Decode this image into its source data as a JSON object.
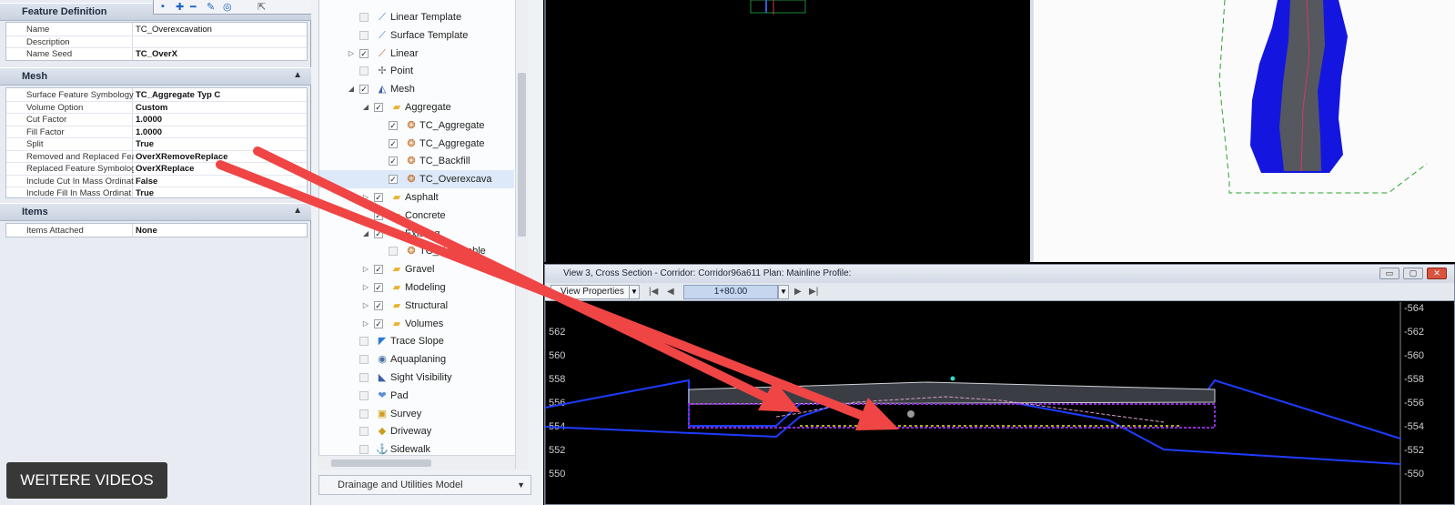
{
  "toolbar": {
    "icons": [
      "select-icon",
      "add-icon",
      "remove-icon",
      "edit-icon",
      "target-icon"
    ]
  },
  "feature_definition": {
    "title": "Feature Definition",
    "rows": [
      {
        "key": "Name",
        "value": "TC_Overexcavation"
      },
      {
        "key": "Description",
        "value": ""
      },
      {
        "key": "Name Seed",
        "value": "TC_OverX"
      }
    ]
  },
  "mesh": {
    "title": "Mesh",
    "rows": [
      {
        "key": "Surface Feature Symbology",
        "value": "TC_Aggregate Typ C"
      },
      {
        "key": "Volume Option",
        "value": "Custom"
      },
      {
        "key": "Cut Factor",
        "value": "1.0000"
      },
      {
        "key": "Fill Factor",
        "value": "1.0000"
      },
      {
        "key": "Split",
        "value": "True"
      },
      {
        "key": "Removed and Replaced Fea",
        "value": "OverXRemoveReplace"
      },
      {
        "key": "Replaced Feature Symbolog",
        "value": "OverXReplace"
      },
      {
        "key": "Include Cut In Mass Ordinat",
        "value": "False"
      },
      {
        "key": "Include Fill In Mass Ordinat",
        "value": "True"
      }
    ]
  },
  "items": {
    "title": "Items",
    "rows": [
      {
        "key": "Items Attached",
        "value": "None"
      }
    ]
  },
  "tree": {
    "items": [
      {
        "label": "Linear Template",
        "level": 1,
        "checked": false,
        "expand": "",
        "icon": "template-icon"
      },
      {
        "label": "Surface Template",
        "level": 1,
        "checked": false,
        "expand": "",
        "icon": "template-icon"
      },
      {
        "label": "Linear",
        "level": 1,
        "checked": true,
        "expand": "▷",
        "icon": "linear-icon"
      },
      {
        "label": "Point",
        "level": 1,
        "checked": false,
        "expand": "",
        "icon": "point-icon"
      },
      {
        "label": "Mesh",
        "level": 1,
        "checked": true,
        "expand": "◢",
        "icon": "mesh-icon"
      },
      {
        "label": "Aggregate",
        "level": 2,
        "checked": true,
        "expand": "◢",
        "icon": "folder-icon"
      },
      {
        "label": "TC_Aggregate",
        "level": 3,
        "checked": true,
        "expand": "",
        "icon": "feature-icon"
      },
      {
        "label": "TC_Aggregate",
        "level": 3,
        "checked": true,
        "expand": "",
        "icon": "feature-icon"
      },
      {
        "label": "TC_Backfill",
        "level": 3,
        "checked": true,
        "expand": "",
        "icon": "feature-icon"
      },
      {
        "label": "TC_Overexcava",
        "level": 3,
        "checked": true,
        "expand": "",
        "icon": "feature-icon",
        "selected": true
      },
      {
        "label": "Asphalt",
        "level": 2,
        "checked": true,
        "expand": "▷",
        "icon": "folder-icon"
      },
      {
        "label": "Concrete",
        "level": 2,
        "checked": true,
        "expand": "",
        "icon": "folder-icon"
      },
      {
        "label": "Existing",
        "level": 2,
        "checked": true,
        "expand": "◢",
        "icon": "folder-icon"
      },
      {
        "label": "TC_Unsuitable",
        "level": 3,
        "checked": false,
        "expand": "",
        "icon": "feature-icon"
      },
      {
        "label": "Gravel",
        "level": 2,
        "checked": true,
        "expand": "▷",
        "icon": "folder-icon"
      },
      {
        "label": "Modeling",
        "level": 2,
        "checked": true,
        "expand": "▷",
        "icon": "folder-icon"
      },
      {
        "label": "Structural",
        "level": 2,
        "checked": true,
        "expand": "▷",
        "icon": "folder-icon"
      },
      {
        "label": "Volumes",
        "level": 2,
        "checked": true,
        "expand": "▷",
        "icon": "folder-icon"
      },
      {
        "label": "Trace Slope",
        "level": 1,
        "checked": false,
        "expand": "",
        "icon": "trace-slope-icon"
      },
      {
        "label": "Aquaplaning",
        "level": 1,
        "checked": false,
        "expand": "",
        "icon": "aquaplaning-icon"
      },
      {
        "label": "Sight Visibility",
        "level": 1,
        "checked": false,
        "expand": "",
        "icon": "sight-visibility-icon"
      },
      {
        "label": "Pad",
        "level": 1,
        "checked": false,
        "expand": "",
        "icon": "pad-icon"
      },
      {
        "label": "Survey",
        "level": 1,
        "checked": false,
        "expand": "",
        "icon": "survey-icon"
      },
      {
        "label": "Driveway",
        "level": 1,
        "checked": false,
        "expand": "",
        "icon": "driveway-icon"
      },
      {
        "label": "Sidewalk",
        "level": 1,
        "checked": false,
        "expand": "",
        "icon": "sidewalk-icon"
      }
    ]
  },
  "model_bar": {
    "label": "Drainage and Utilities Model"
  },
  "cross_section": {
    "title": "View 3, Cross Section - Corridor: Corridor96a611 Plan: Mainline Profile:",
    "view_properties": "View Properties",
    "station": "1+80.00",
    "elevations_left": [
      "562",
      "560",
      "558",
      "556",
      "554",
      "552",
      "550"
    ],
    "elevations_right": [
      "564",
      "562",
      "560",
      "558",
      "556",
      "554",
      "552",
      "550"
    ]
  },
  "overlay": {
    "more_videos": "WEITERE VIDEOS"
  },
  "colors": {
    "ground_line": "#1e3cff",
    "pavement": "#cfd2d8",
    "overexcavation": "#8c2bd8",
    "aggregate": "#d7a0c8",
    "datum": "#e7e02a",
    "arrow": "#f04545"
  }
}
